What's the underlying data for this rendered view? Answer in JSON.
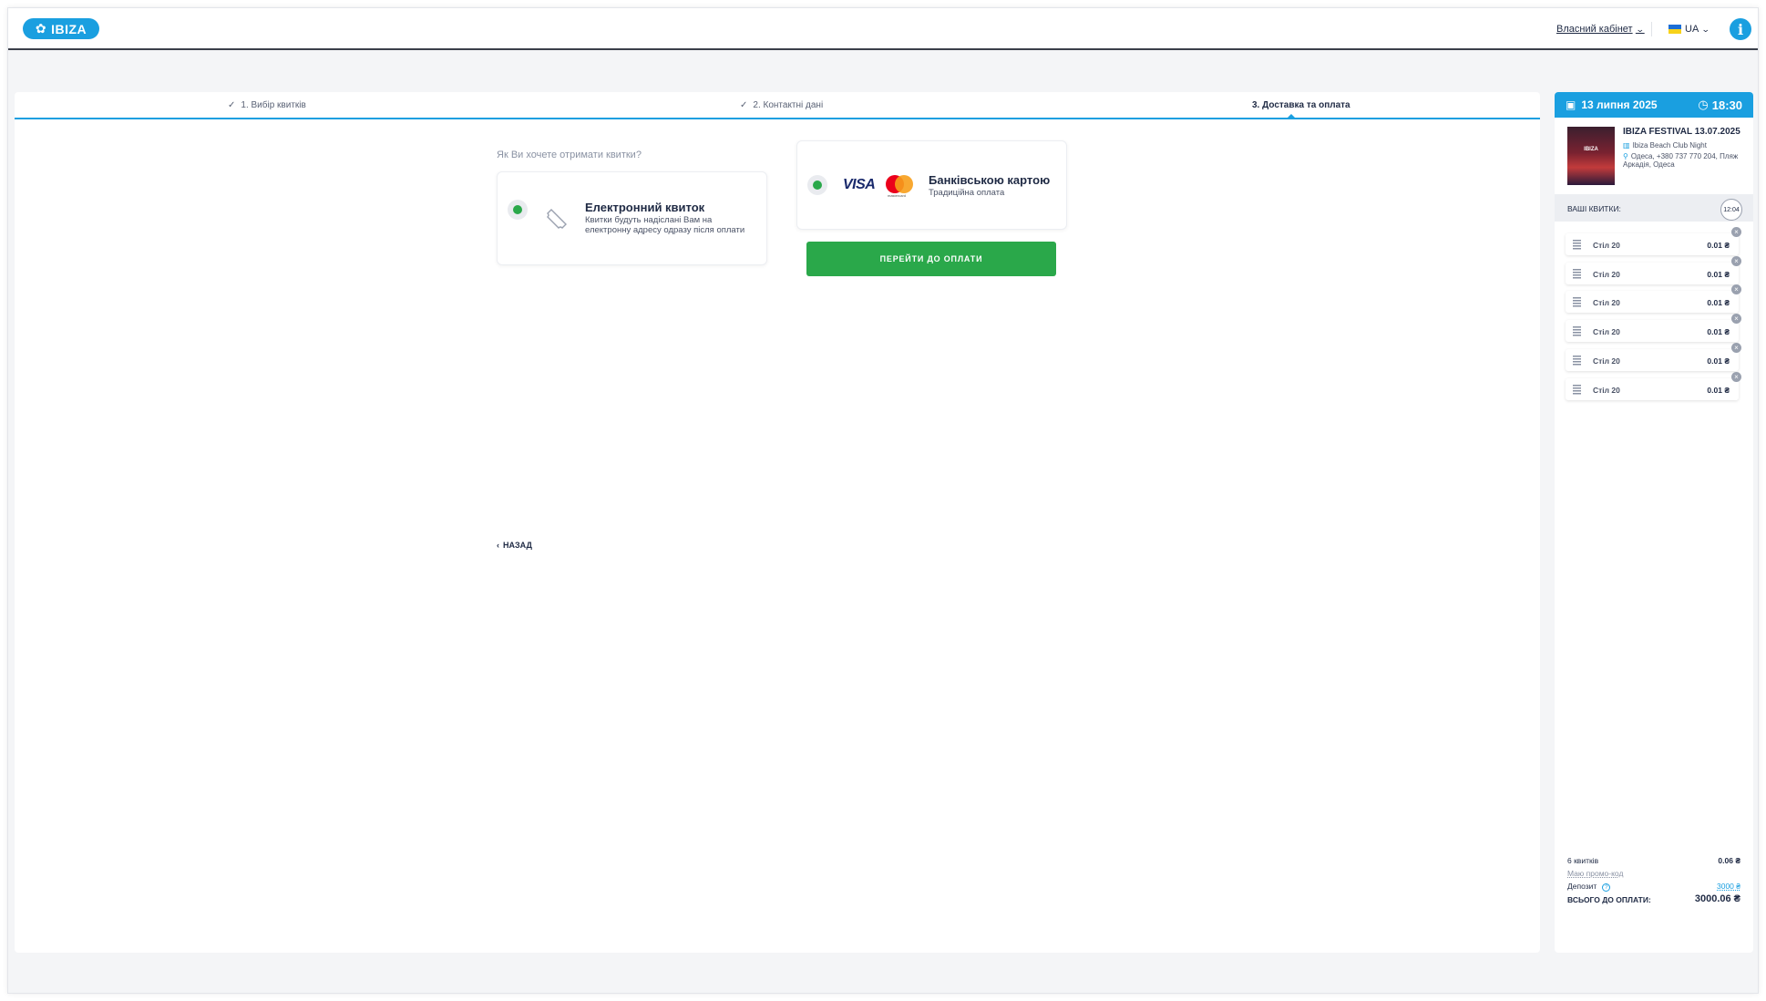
{
  "header": {
    "logo_text": "IBIZA",
    "cabinet_label": "Власний кабінет",
    "language": "UA",
    "info_label": "i"
  },
  "steps": [
    {
      "label": "1. Вибір квитків",
      "done": true
    },
    {
      "label": "2. Контактні дані",
      "done": true
    },
    {
      "label": "3. Доставка та оплата",
      "done": false
    }
  ],
  "delivery": {
    "question": "Як Ви хочете отримати квитки?",
    "eticket_title": "Електронний квиток",
    "eticket_desc_1": "Квитки будуть надіслані Вам на",
    "eticket_desc_2": "електронну адресу одразу після оплати"
  },
  "payment": {
    "visa_label": "VISA",
    "mastercard_label": "mastercard",
    "card_title": "Банківською картою",
    "card_desc": "Традиційна оплата",
    "pay_button": "ПЕРЕЙТИ ДО ОПЛАТИ"
  },
  "back_label": "НАЗАД",
  "sidebar": {
    "date": "13 липня 2025",
    "time": "18:30",
    "poster_text": "IBIZA",
    "event_title": "IBIZA FESTIVAL 13.07.2025",
    "venue": "Ibiza Beach Club Night",
    "address_1": "Одеса, +380 737 770 204, Пляж",
    "address_2": "Аркадія, Одеса",
    "tickets_label": "ВАШІ КВИТКИ:",
    "timer": "12:04",
    "tickets": [
      {
        "name": "Стіл 20",
        "price": "0.01 ₴"
      },
      {
        "name": "Стіл 20",
        "price": "0.01 ₴"
      },
      {
        "name": "Стіл 20",
        "price": "0.01 ₴"
      },
      {
        "name": "Стіл 20",
        "price": "0.01 ₴"
      },
      {
        "name": "Стіл 20",
        "price": "0.01 ₴"
      },
      {
        "name": "Стіл 20",
        "price": "0.01 ₴"
      }
    ],
    "count_label": "6 квитків",
    "count_value": "0.06 ₴",
    "promo_label": "Маю промо-код",
    "deposit_label": "Депозит",
    "deposit_value": "3000 ₴",
    "total_label": "всього до оплати:",
    "total_value": "3000.06 ₴"
  },
  "colors": {
    "accent": "#1a9fe0",
    "success": "#2aa84a",
    "text": "#1f2a44"
  }
}
